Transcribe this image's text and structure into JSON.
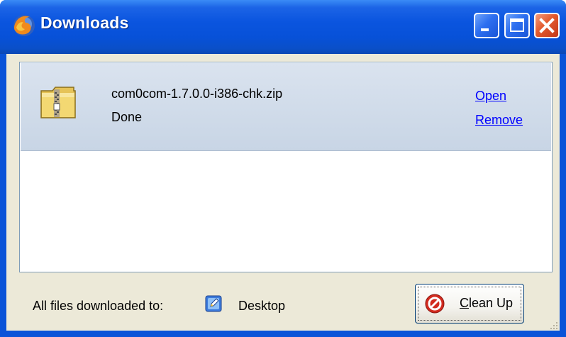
{
  "window": {
    "title": "Downloads",
    "app_icon": "firefox-icon",
    "controls": [
      "minimize-icon",
      "maximize-icon",
      "close-icon"
    ]
  },
  "downloads": [
    {
      "icon": "zip-folder-icon",
      "filename": "com0com-1.7.0.0-i386-chk.zip",
      "status": "Done",
      "actions": {
        "open": "Open",
        "remove": "Remove"
      }
    }
  ],
  "footer": {
    "label": "All files downloaded to:",
    "folder_icon": "desktop-folder-icon",
    "folder": "Desktop",
    "cleanup_button": "Clean Up",
    "cleanup_icon": "no-entry-icon"
  },
  "colors": {
    "titlebar": "#0b55df",
    "item_background": "#dae3ef",
    "link": "#0000ff",
    "client": "#ece9d8"
  }
}
